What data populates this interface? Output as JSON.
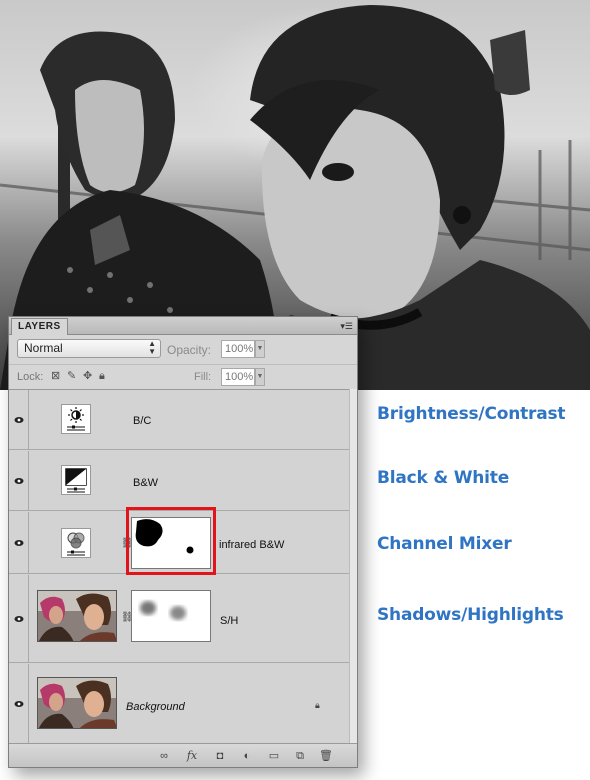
{
  "panel": {
    "tab_label": "LAYERS",
    "menu_icon": "panel-menu-icon",
    "blend_mode": "Normal",
    "opacity_label": "Opacity:",
    "opacity_value": "100%",
    "lock_label": "Lock:",
    "fill_label": "Fill:",
    "fill_value": "100%"
  },
  "layers": [
    {
      "name": "B/C",
      "type": "adjustment",
      "icon": "brightness-contrast-icon",
      "visible": true
    },
    {
      "name": "B&W",
      "type": "adjustment",
      "icon": "black-white-icon",
      "visible": true
    },
    {
      "name": "infrared B&W",
      "type": "adjustment",
      "icon": "channel-mixer-icon",
      "visible": true,
      "has_mask": true,
      "highlighted": true
    },
    {
      "name": "S/H",
      "type": "smart",
      "icon": "photo-thumbnail",
      "visible": true,
      "has_mask": true
    },
    {
      "name": "Background",
      "type": "background",
      "icon": "photo-thumbnail",
      "visible": true,
      "locked": true
    }
  ],
  "footer_icons": [
    "link-layers-icon",
    "fx-icon",
    "add-mask-icon",
    "adjustment-layer-icon",
    "group-icon",
    "new-layer-icon",
    "trash-icon"
  ],
  "side_labels": [
    "Brightness/Contrast",
    "Black & White",
    "Channel Mixer",
    "Shadows/Highlights"
  ],
  "colors": {
    "label_blue": "#2f75c4",
    "highlight_red": "#e1131b"
  }
}
